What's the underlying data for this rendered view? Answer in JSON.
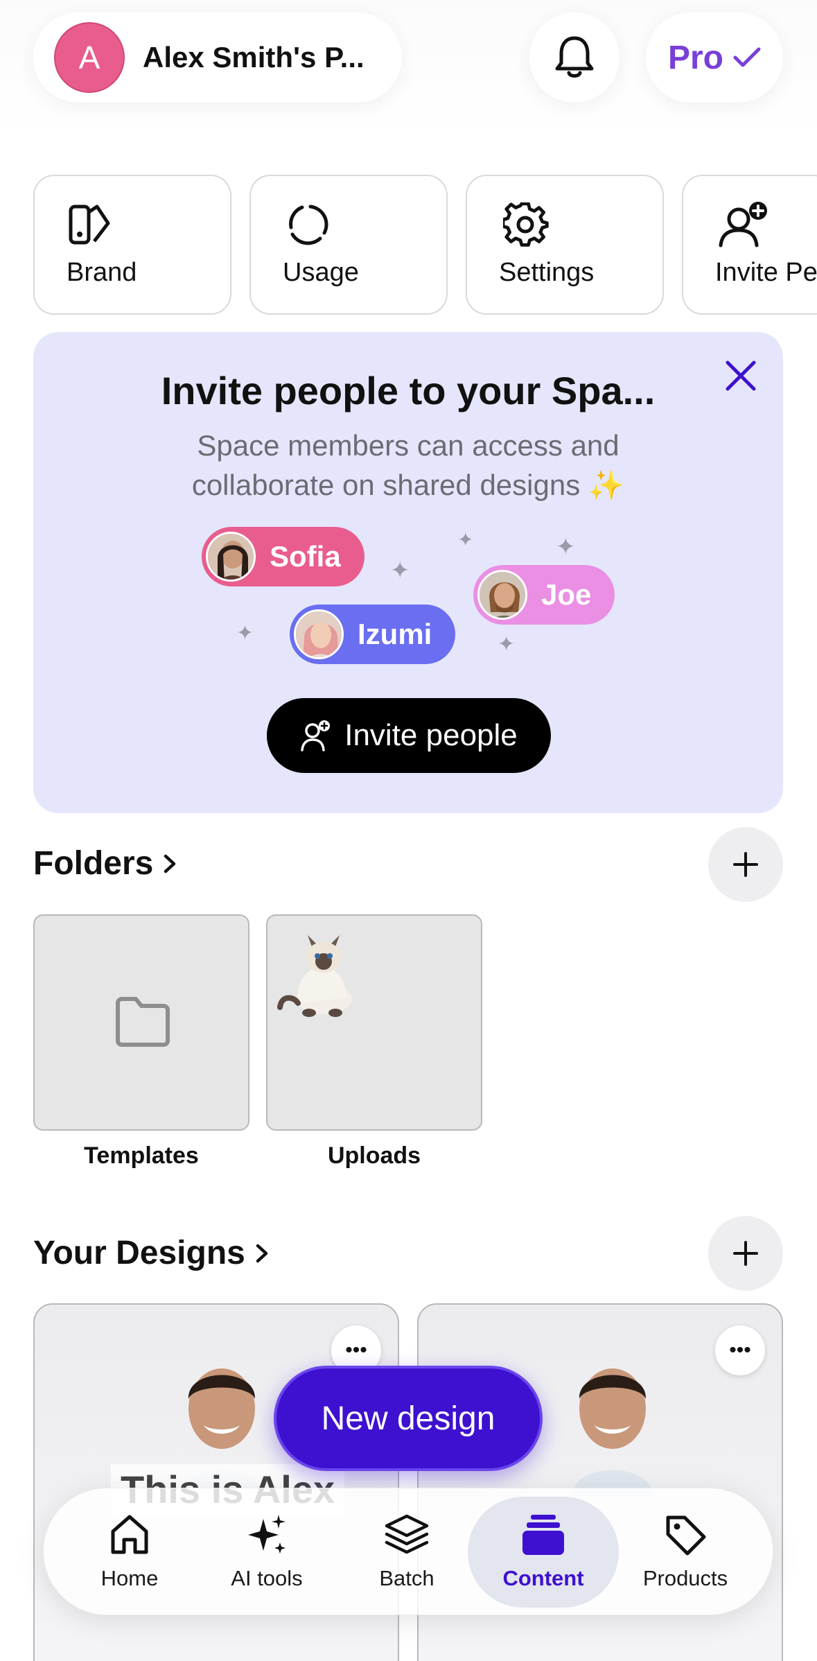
{
  "header": {
    "avatar_initial": "A",
    "account_name": "Alex Smith's P...",
    "pro_label": "Pro"
  },
  "quick_actions": [
    {
      "label": "Brand",
      "icon": "brand-kit-icon"
    },
    {
      "label": "Usage",
      "icon": "usage-ring-icon"
    },
    {
      "label": "Settings",
      "icon": "gear-icon"
    },
    {
      "label": "Invite Pe",
      "icon": "invite-person-icon"
    }
  ],
  "invite_card": {
    "title": "Invite people to your Spa...",
    "subtitle_line1": "Space members can access and",
    "subtitle_line2": "collaborate on shared designs ✨",
    "members": [
      "Sofia",
      "Izumi",
      "Joe"
    ],
    "button_label": "Invite people"
  },
  "folders": {
    "title": "Folders",
    "items": [
      {
        "label": "Templates"
      },
      {
        "label": "Uploads"
      }
    ]
  },
  "designs": {
    "title": "Your Designs",
    "first_design_text": "This is Alex"
  },
  "new_design_label": "New design",
  "bottom_nav": [
    {
      "label": "Home",
      "icon": "home-icon"
    },
    {
      "label": "AI tools",
      "icon": "sparkles-icon"
    },
    {
      "label": "Batch",
      "icon": "layers-icon"
    },
    {
      "label": "Content",
      "icon": "content-stack-icon",
      "active": true
    },
    {
      "label": "Products",
      "icon": "tag-icon"
    }
  ],
  "colors": {
    "accent": "#3d11cf",
    "pro": "#7a3fd8",
    "avatar": "#e95d8e",
    "invite_card_bg": "#e5e6fb",
    "chip_sofia": "#e95d8e",
    "chip_izumi": "#6a6ef0",
    "chip_joe": "#ea8fe3"
  }
}
